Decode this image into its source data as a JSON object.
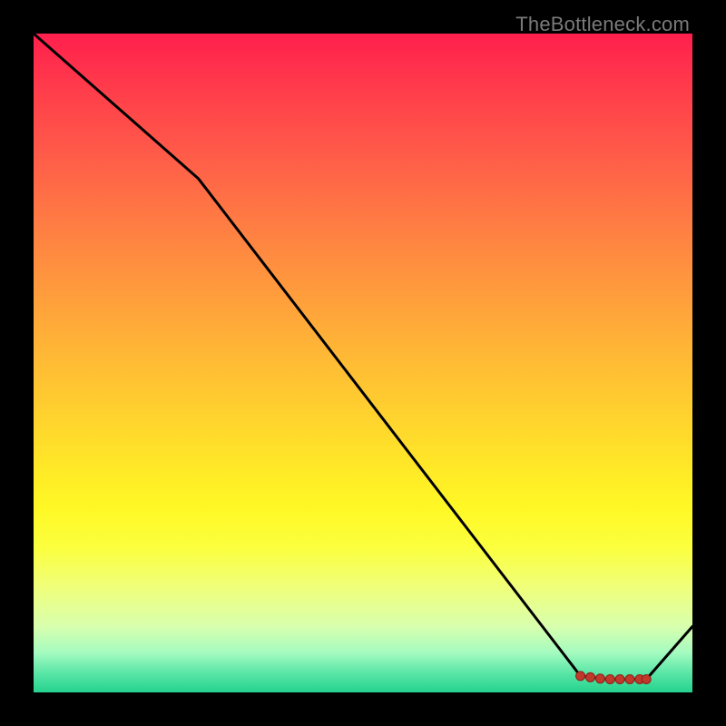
{
  "watermark": "TheBottleneck.com",
  "chart_data": {
    "type": "line",
    "title": "",
    "xlabel": "",
    "ylabel": "",
    "xlim": [
      0,
      100
    ],
    "ylim": [
      0,
      100
    ],
    "series": [
      {
        "name": "curve",
        "x": [
          0,
          25,
          83,
          87,
          93,
          100
        ],
        "values": [
          100,
          78,
          2.5,
          2,
          2,
          10
        ]
      }
    ],
    "markers": {
      "name": "highlight-band",
      "x": [
        83,
        84.5,
        86,
        87.5,
        89,
        90.5,
        92,
        93
      ],
      "values": [
        2.5,
        2.3,
        2.1,
        2.0,
        2.0,
        2.0,
        2.0,
        2.0
      ]
    }
  }
}
